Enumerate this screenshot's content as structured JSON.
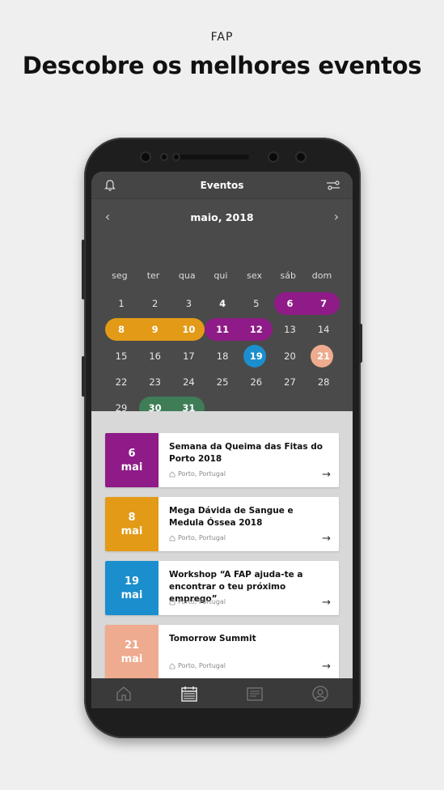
{
  "promo": {
    "brand": "FAP",
    "headline": "Descobre os melhores eventos"
  },
  "app": {
    "title": "Eventos",
    "icons": {
      "left": "bell-icon",
      "right": "filter-icon"
    }
  },
  "calendar": {
    "month": "maio, 2018",
    "prev_icon": "chevron-left-icon",
    "next_icon": "chevron-right-icon",
    "weekdays": [
      "seg",
      "ter",
      "qua",
      "qui",
      "sex",
      "sáb",
      "dom"
    ],
    "weeks": [
      [
        "1",
        "2",
        "3",
        "4",
        "5",
        "6",
        "7"
      ],
      [
        "8",
        "9",
        "10",
        "11",
        "12",
        "13",
        "14"
      ],
      [
        "15",
        "16",
        "17",
        "18",
        "19",
        "20",
        "21"
      ],
      [
        "22",
        "23",
        "24",
        "25",
        "26",
        "27",
        "28"
      ],
      [
        "29",
        "30",
        "31",
        "",
        "",
        "",
        ""
      ]
    ],
    "highlight_colors": {
      "purple": "#8e1b87",
      "orange": "#e39a17",
      "blue": "#1b8fce",
      "salmon": "#efab8f",
      "green": "#3f7d57"
    }
  },
  "events": [
    {
      "day": "6",
      "month": "mai",
      "title": "Semana da Queima das Fitas do Porto 2018",
      "location": "Porto, Portugal",
      "color": "#8e1b87"
    },
    {
      "day": "8",
      "month": "mai",
      "title": "Mega Dávida de Sangue e Medula Óssea 2018",
      "location": "Porto, Portugal",
      "color": "#e39a17"
    },
    {
      "day": "19",
      "month": "mai",
      "title": "Workshop “A FAP ajuda-te a encontrar o teu próximo emprego”",
      "location": "Porto, Portugal",
      "color": "#1b8fce"
    },
    {
      "day": "21",
      "month": "mai",
      "title": "Tomorrow Summit",
      "location": "Porto, Portugal",
      "color": "#efab8f"
    }
  ],
  "tabbar": {
    "items": [
      "home-icon",
      "calendar-icon",
      "news-icon",
      "profile-icon"
    ]
  }
}
